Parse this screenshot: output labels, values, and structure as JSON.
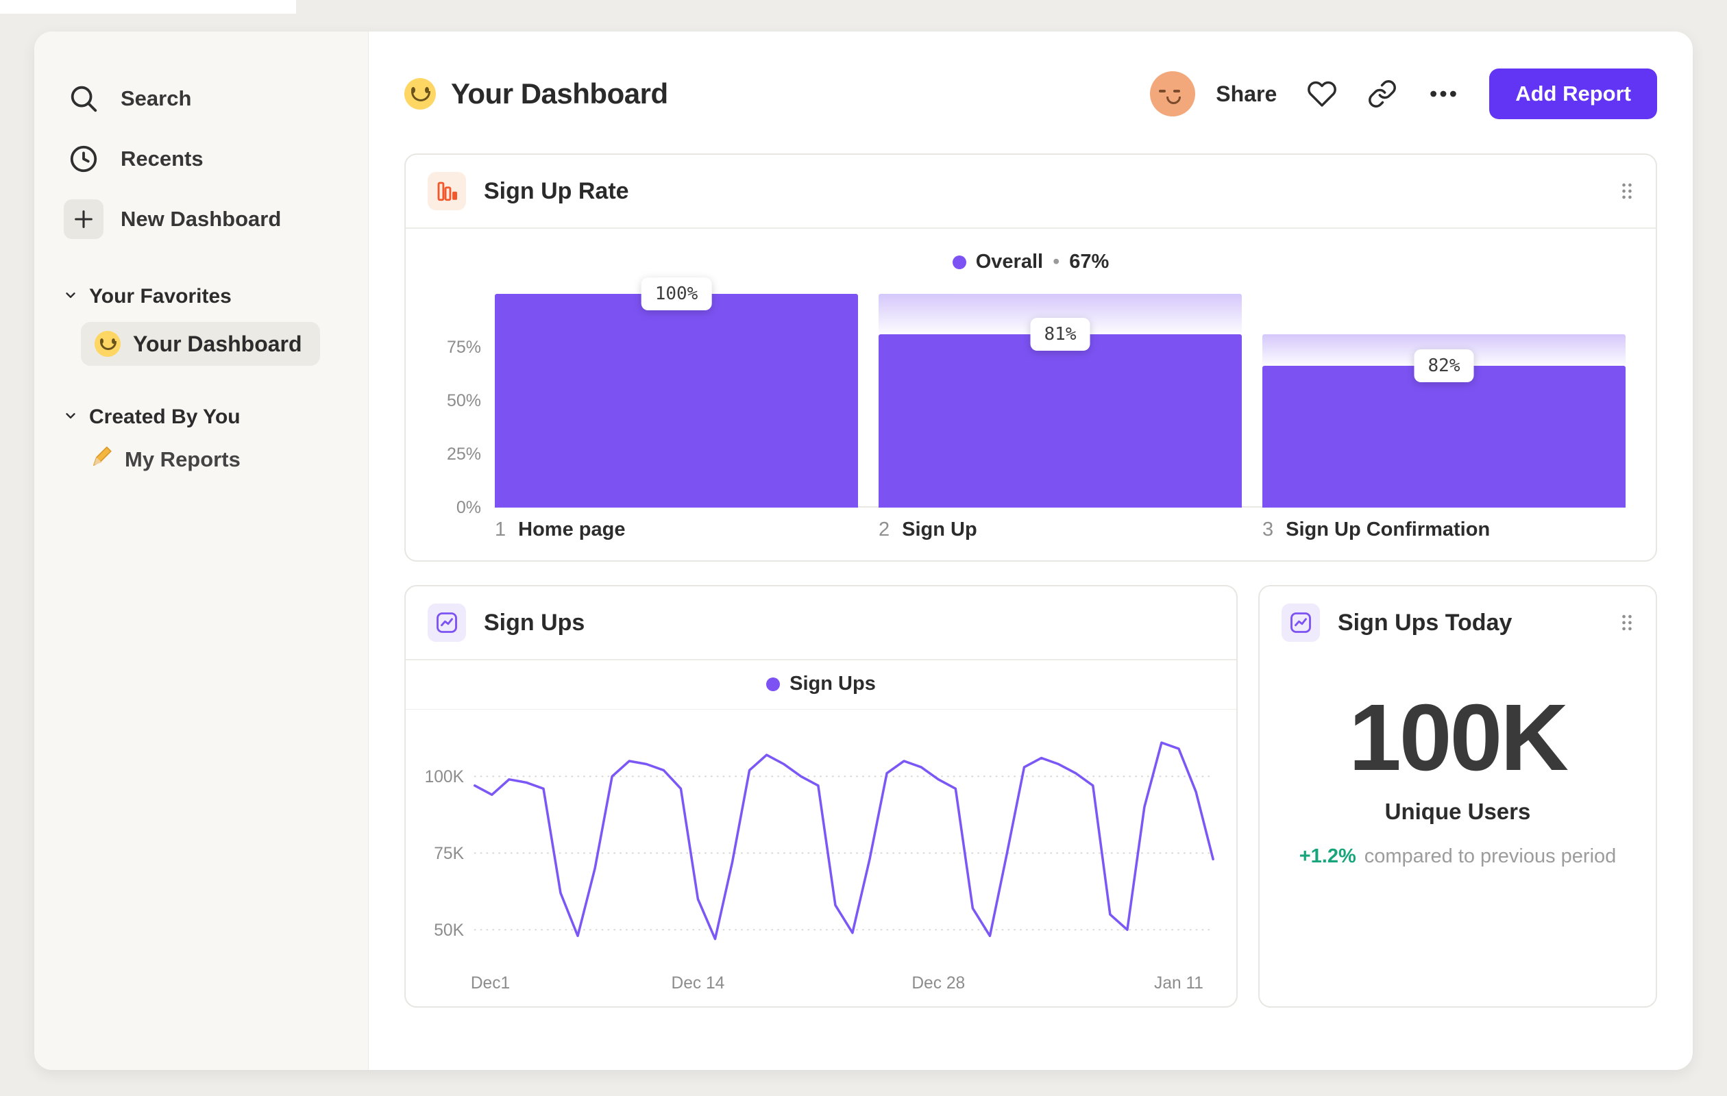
{
  "colors": {
    "accent_purple": "#7C52F2",
    "button_purple": "#6135F3",
    "accent_orange": "#F1582B",
    "positive_green": "#17A57C",
    "sidebar_bg": "#F8F7F4",
    "page_bg": "#EFEDEA"
  },
  "sidebar": {
    "nav": [
      {
        "label": "Search",
        "icon": "search-icon"
      },
      {
        "label": "Recents",
        "icon": "clock-icon"
      },
      {
        "label": "New Dashboard",
        "icon": "plus-icon"
      }
    ],
    "sections": [
      {
        "title": "Your Favorites",
        "items": [
          {
            "emoji": "🙂",
            "label": "Your Dashboard",
            "selected": true
          }
        ]
      },
      {
        "title": "Created By You",
        "items": [
          {
            "emoji": "✏️",
            "label": "My Reports",
            "selected": false
          }
        ]
      }
    ]
  },
  "header": {
    "title_emoji": "🙂",
    "title": "Your Dashboard",
    "avatar_emoji": "😌",
    "share_label": "Share",
    "add_report_label": "Add Report"
  },
  "cards": {
    "funnel": {
      "title": "Sign Up Rate",
      "legend_name": "Overall",
      "legend_sep": "•",
      "legend_value": "67%"
    },
    "line": {
      "title": "Sign Ups",
      "legend_name": "Sign Ups"
    },
    "today": {
      "title": "Sign Ups Today",
      "value": "100K",
      "label": "Unique Users",
      "delta": "+1.2%",
      "delta_desc": "compared to previous period"
    }
  },
  "chart_data": [
    {
      "type": "bar",
      "title": "Sign Up Rate",
      "legend": "Overall • 67%",
      "categories": [
        "Home page",
        "Sign Up",
        "Sign Up Confirmation"
      ],
      "values": [
        100,
        81,
        82
      ],
      "value_labels": [
        "100%",
        "81%",
        "82%"
      ],
      "steps": [
        {
          "number": "1",
          "name": "Home page",
          "conversion_label": "100%",
          "height_pct": 100
        },
        {
          "number": "2",
          "name": "Sign Up",
          "conversion_label": "81%",
          "height_pct": 81
        },
        {
          "number": "3",
          "name": "Sign Up Confirmation",
          "conversion_label": "82%",
          "height_pct": 66.4
        }
      ],
      "y_ticks": [
        {
          "label": "75%",
          "value": 75
        },
        {
          "label": "50%",
          "value": 50
        },
        {
          "label": "25%",
          "value": 25
        },
        {
          "label": "0%",
          "value": 0
        }
      ],
      "ylim": [
        0,
        100
      ],
      "bar_color": "#7C52F2"
    },
    {
      "type": "line",
      "title": "Sign Ups",
      "series": [
        {
          "name": "Sign Ups",
          "unit": "K",
          "values": [
            97,
            94,
            99,
            98,
            96,
            62,
            48,
            70,
            100,
            105,
            104,
            102,
            96,
            60,
            47,
            72,
            102,
            107,
            104,
            100,
            97,
            58,
            49,
            73,
            101,
            105,
            103,
            99,
            96,
            57,
            48,
            75,
            103,
            106,
            104,
            101,
            97,
            55,
            50,
            90,
            111,
            109,
            95,
            73
          ]
        }
      ],
      "x_ticks": [
        {
          "label": "Dec1",
          "day": 0
        },
        {
          "label": "Dec 14",
          "day": 13
        },
        {
          "label": "Dec 28",
          "day": 27
        },
        {
          "label": "Jan 11",
          "day": 41
        }
      ],
      "total_days": 44,
      "y_ticks": [
        {
          "label": "100K",
          "value": 100
        },
        {
          "label": "75K",
          "value": 75
        },
        {
          "label": "50K",
          "value": 50
        }
      ],
      "ylim": [
        44,
        116
      ],
      "line_color": "#7B58F5",
      "grid": "dotted-horizontal",
      "legend_position": "top-center"
    }
  ]
}
